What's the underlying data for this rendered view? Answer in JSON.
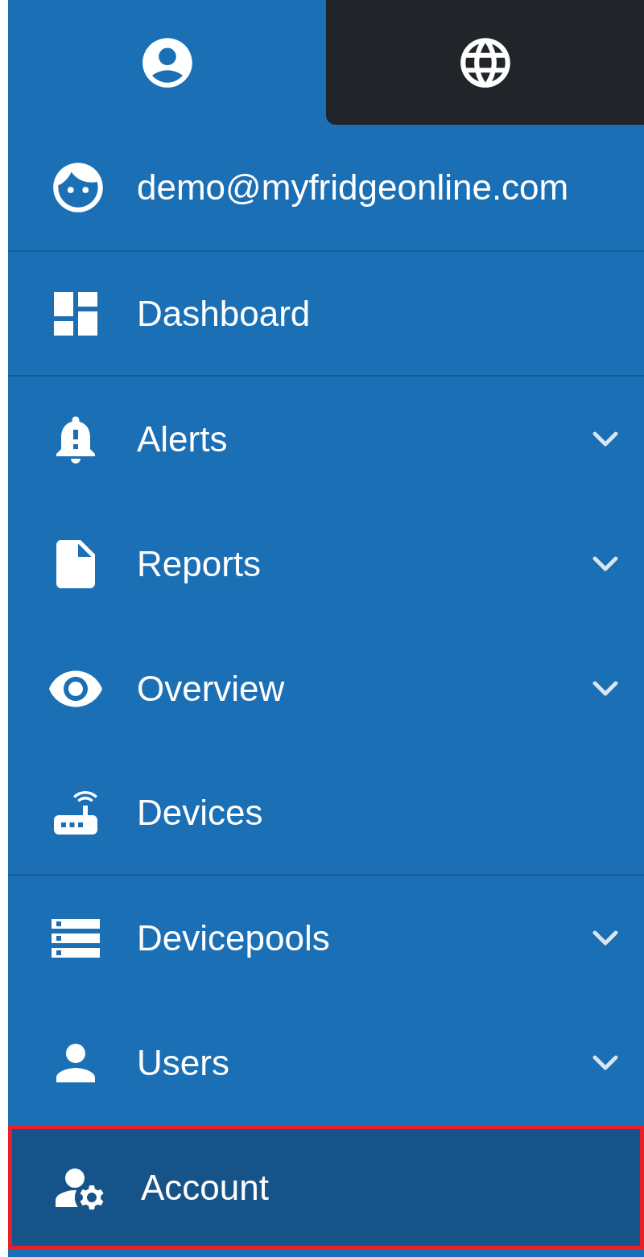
{
  "tabs": [
    {
      "selected": true
    },
    {
      "selected": false
    }
  ],
  "user": {
    "email": "demo@myfridgeonline.com"
  },
  "menu": [
    {
      "label": "Dashboard",
      "expandable": false,
      "selected": false,
      "separated": true
    },
    {
      "label": "Alerts",
      "expandable": true,
      "selected": false,
      "separated": false
    },
    {
      "label": "Reports",
      "expandable": true,
      "selected": false,
      "separated": false
    },
    {
      "label": "Overview",
      "expandable": true,
      "selected": false,
      "separated": false
    },
    {
      "label": "Devices",
      "expandable": false,
      "selected": false,
      "separated": true
    },
    {
      "label": "Devicepools",
      "expandable": true,
      "selected": false,
      "separated": false
    },
    {
      "label": "Users",
      "expandable": true,
      "selected": false,
      "separated": false
    },
    {
      "label": "Account",
      "expandable": false,
      "selected": true,
      "separated": false
    }
  ]
}
